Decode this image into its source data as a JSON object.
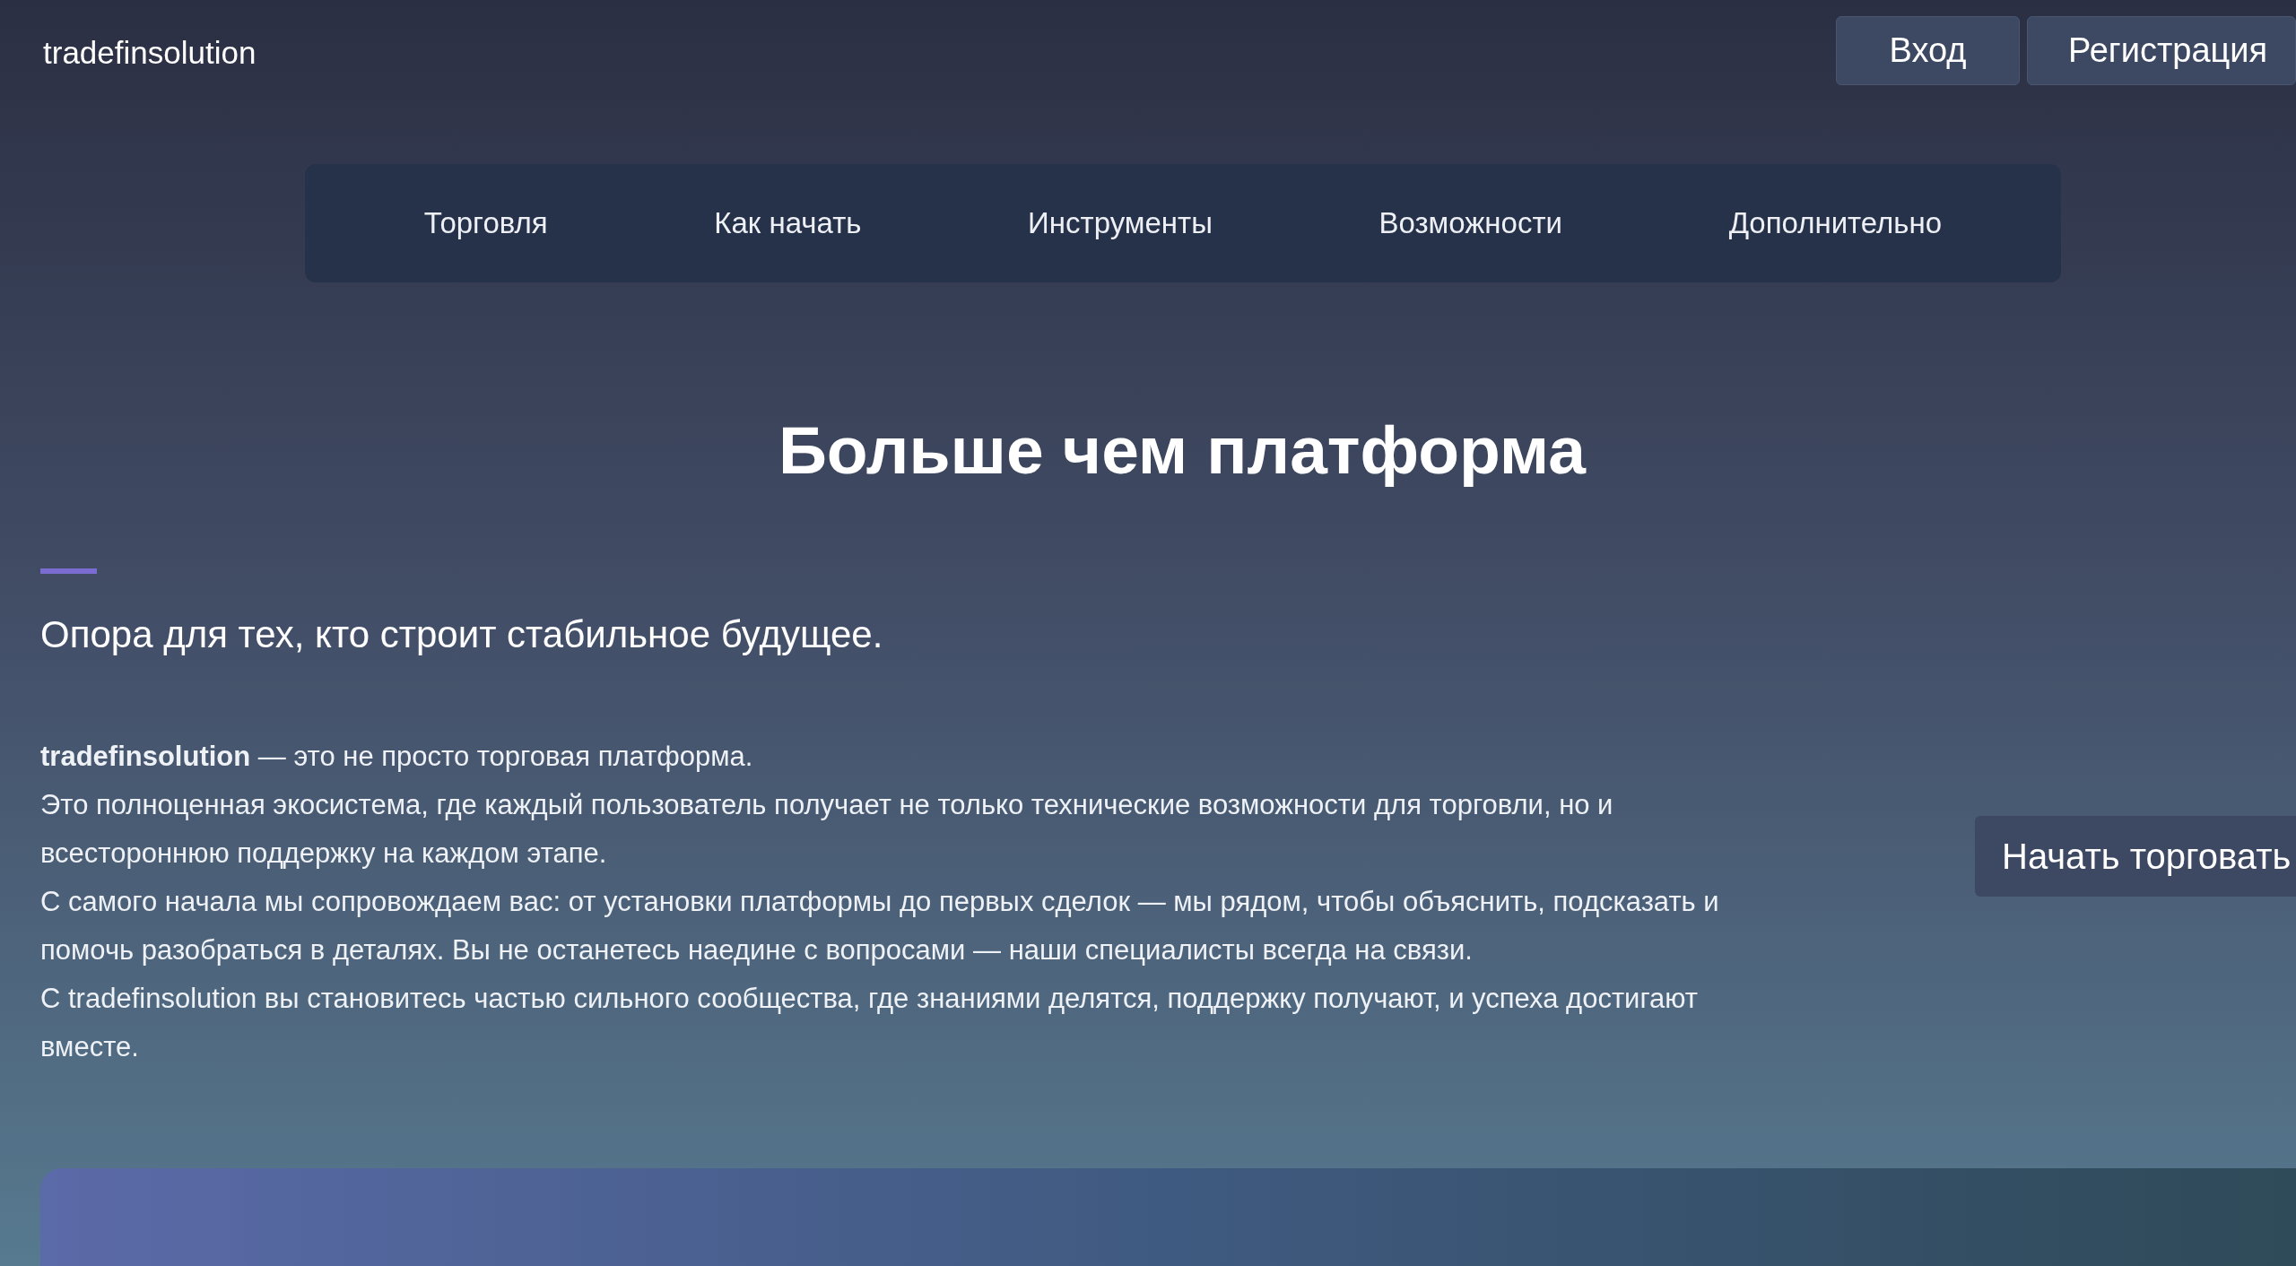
{
  "header": {
    "logo": "tradefinsolution",
    "buttons": [
      "Вход",
      "Регистрация"
    ]
  },
  "nav": {
    "items": [
      "Торговля",
      "Как начать",
      "Инструменты",
      "Возможности",
      "Дополнительно"
    ]
  },
  "hero": {
    "title": "Больше чем платформа",
    "subtitle": "Опора для тех, кто строит стабильное будущее.",
    "paragraphs": [
      "**tradefinsolution** — это не просто торговая платформа.",
      "Это полноценная экосистема, где каждый пользователь получает не только технические возможности для торговли, но и всестороннюю поддержку на каждом этапе.",
      "С самого начала мы сопровождаем вас: от установки платформы до первых сделок — мы рядом, чтобы объяснить, подсказать и помочь разобраться в деталях. Вы не останетесь наедине с вопросами — наши специалисты всегда на связи.",
      "С tradefinsolution вы становитесь частью сильного сообщества, где знаниями делятся, поддержку получают, и успеха достигают вместе."
    ],
    "cta": "Начать торговать"
  }
}
